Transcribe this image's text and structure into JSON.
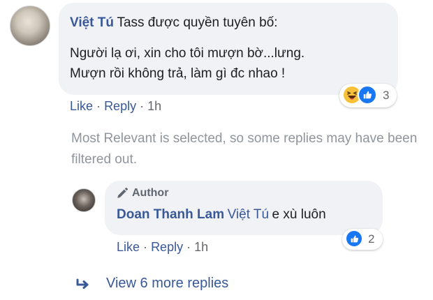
{
  "comment": {
    "author": "Việt Tú",
    "intro": "Tass được quyền tuyên bố:",
    "line1": "Người lạ ơi, xin cho tôi mượn bờ...lưng.",
    "line2": "Mượn rồi không trả, làm gì đc nhao !",
    "reaction_count": "3",
    "reactions": [
      "haha-emoji",
      "like-emoji"
    ],
    "actions": {
      "like": "Like",
      "reply": "Reply",
      "separator": "·",
      "time": "1h"
    }
  },
  "notice": "Most Relevant is selected, so some replies may have been filtered out.",
  "reply": {
    "badge": "Author",
    "author": "Doan Thanh Lam",
    "mention": "Việt Tú",
    "text": "e xù luôn",
    "reaction_count": "2",
    "actions": {
      "like": "Like",
      "reply": "Reply",
      "separator": "·",
      "time": "1h"
    }
  },
  "more_replies": "View 6 more replies",
  "colors": {
    "link": "#385898",
    "bubble": "#f0f2f5",
    "muted": "#90949c",
    "like_blue": "#1877f2",
    "haha_yellow": "#f7c13a"
  }
}
